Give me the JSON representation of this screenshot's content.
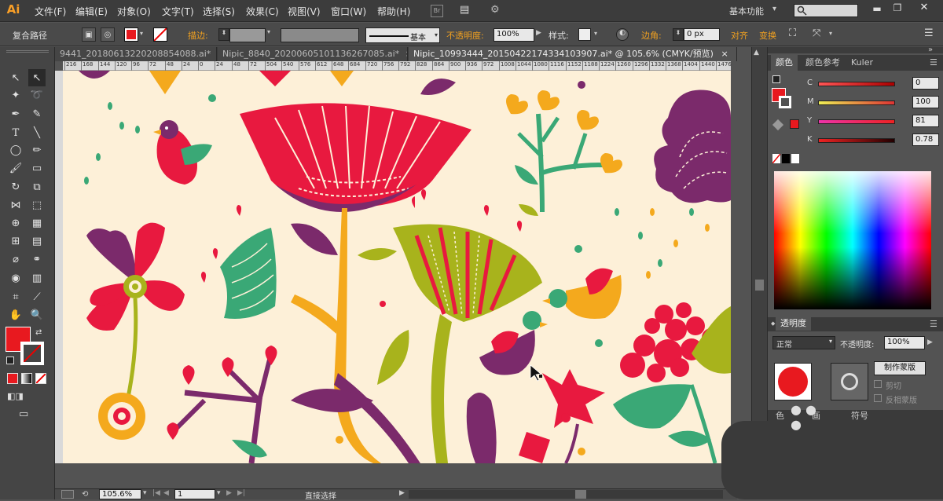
{
  "app": {
    "logo": "Ai",
    "workspace": "基本功能",
    "workspace_menu": "▾"
  },
  "menus": [
    "文件(F)",
    "编辑(E)",
    "对象(O)",
    "文字(T)",
    "选择(S)",
    "效果(C)",
    "视图(V)",
    "窗口(W)",
    "帮助(H)"
  ],
  "menubar_icons": {
    "br": "Br",
    "arrange": "▤",
    "sync": "⚙"
  },
  "control": {
    "selection_label": "复合路径",
    "stroke_label": "描边:",
    "stroke_style": "基本",
    "opacity_label": "不透明度:",
    "opacity_value": "100%",
    "style_label": "样式:",
    "corner_label": "边角:",
    "corner_value": "0 px",
    "align_label": "对齐",
    "transform_label": "变换",
    "fill_color": "#e8191f"
  },
  "tabs": [
    {
      "label": "9441_20180613220208854088.ai*",
      "close": "×"
    },
    {
      "label": "Nipic_8840_20200605101136267085.ai*",
      "close": "×"
    },
    {
      "label": "Nipic_10993444_20150422174334103907.ai* @ 105.6% (CMYK/预览)",
      "close": "×"
    }
  ],
  "ruler_ticks": [
    "216",
    "168",
    "144",
    "120",
    "96",
    "72",
    "48",
    "24",
    "0",
    "24",
    "48",
    "72",
    "504",
    "540",
    "576",
    "612",
    "648",
    "684",
    "720",
    "756",
    "792",
    "828",
    "864",
    "900",
    "936",
    "972",
    "1008",
    "1044",
    "1080",
    "1116",
    "1152",
    "1188",
    "1224",
    "1260",
    "1296",
    "1332",
    "1368",
    "1404",
    "1440",
    "1476"
  ],
  "status": {
    "zoom": "105.6%",
    "page": "1",
    "mode": "直接选择",
    "arrow_left": "◀",
    "arrow_right": "▶"
  },
  "color_panel": {
    "tabs": [
      "颜色",
      "颜色参考",
      "Kuler"
    ],
    "channels": [
      {
        "name": "C",
        "value": "0",
        "color": "#d0202a"
      },
      {
        "name": "M",
        "value": "100",
        "color": "#e0c020"
      },
      {
        "name": "Y",
        "value": "81",
        "color": "#d0304a"
      },
      {
        "name": "K",
        "value": "0.78",
        "color": "#a02020"
      }
    ],
    "fill": "#e8191f"
  },
  "transparency_panel": {
    "title": "透明度",
    "mode": "正常",
    "opacity_label": "不透明度:",
    "opacity_value": "100%",
    "make_mask": "制作蒙版",
    "clip": "剪切",
    "invert": "反相蒙版"
  },
  "bottom_tabs": [
    "色",
    "画",
    "符号"
  ],
  "colors": {
    "red": "#e8193f",
    "purple": "#7b2a6b",
    "yellow": "#f4a91d",
    "green": "#3aa876",
    "olive": "#a8b31c",
    "cream": "#fdf0d8"
  }
}
